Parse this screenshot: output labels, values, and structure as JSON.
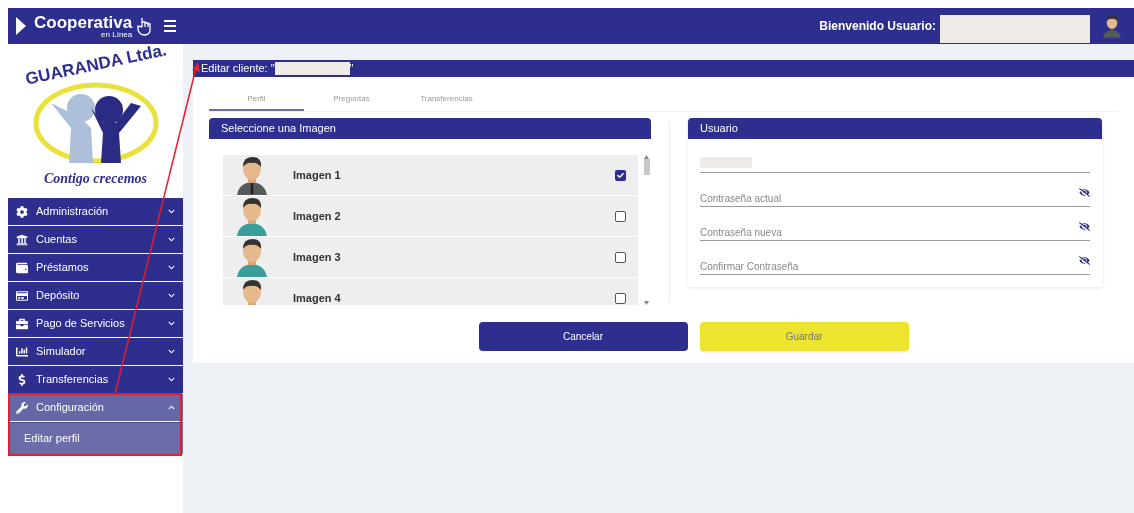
{
  "header": {
    "brand": "Cooperativa",
    "brand_sub": "en Línea",
    "welcome": "Bienvenido Usuario:"
  },
  "logo": {
    "title": "GUARANDA Ltda.",
    "slogan": "Contigo crecemos"
  },
  "sidebar": {
    "items": [
      {
        "label": "Administración",
        "expanded": false
      },
      {
        "label": "Cuentas",
        "expanded": false
      },
      {
        "label": "Préstamos",
        "expanded": false
      },
      {
        "label": "Depósito",
        "expanded": false
      },
      {
        "label": "Pago de Servicios",
        "expanded": false
      },
      {
        "label": "Simulador",
        "expanded": false
      },
      {
        "label": "Transferencias",
        "expanded": false
      },
      {
        "label": "Configuración",
        "expanded": true,
        "children": [
          {
            "label": "Editar perfil"
          }
        ]
      }
    ]
  },
  "page": {
    "title_prefix": "Editar cliente: \"",
    "title_suffix": "\""
  },
  "tabs": [
    {
      "label": "Perfil",
      "selected": true
    },
    {
      "label": "Preguntas",
      "selected": false
    },
    {
      "label": "Transferencias",
      "selected": false
    }
  ],
  "image_panel": {
    "title": "Seleccione una Imagen",
    "images": [
      {
        "label": "Imagen 1",
        "checked": true
      },
      {
        "label": "Imagen 2",
        "checked": false
      },
      {
        "label": "Imagen 3",
        "checked": false
      },
      {
        "label": "Imagen 4",
        "checked": false
      }
    ]
  },
  "user_panel": {
    "title": "Usuario",
    "fields": [
      {
        "placeholder": "Contraseña actual"
      },
      {
        "placeholder": "Contraseña nueva"
      },
      {
        "placeholder": "Confirmar Contraseña"
      }
    ]
  },
  "buttons": [
    {
      "label": "Cancelar",
      "kind": "secondary"
    },
    {
      "label": "Guardar",
      "kind": "primary"
    }
  ]
}
